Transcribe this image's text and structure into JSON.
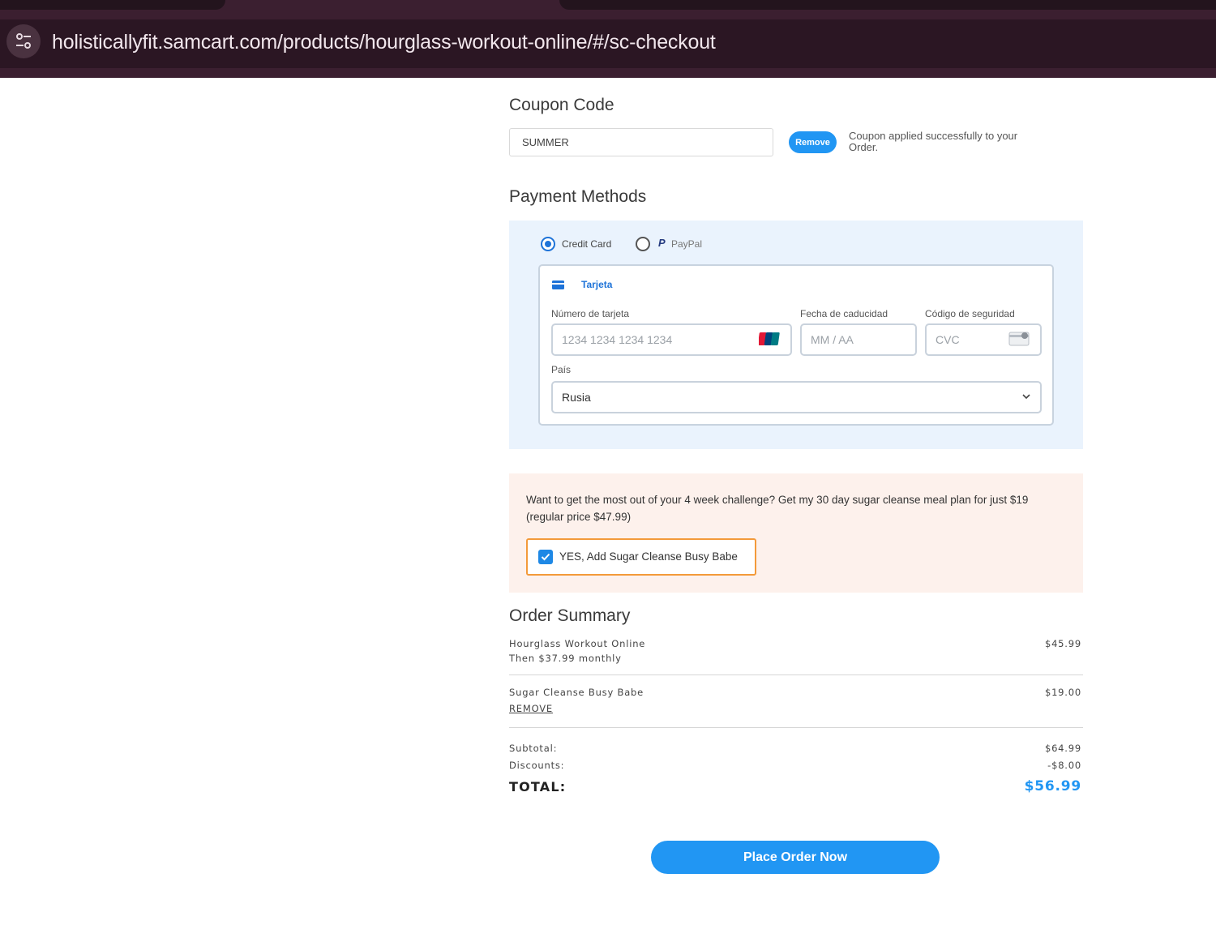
{
  "browser": {
    "url": "holisticallyfit.samcart.com/products/hourglass-workout-online/#/sc-checkout"
  },
  "coupon": {
    "heading": "Coupon Code",
    "value": "SUMMER",
    "remove_label": "Remove",
    "message": "Coupon applied successfully to your Order."
  },
  "payment": {
    "heading": "Payment Methods",
    "methods": [
      {
        "label": "Credit Card",
        "selected": true
      },
      {
        "label": "PayPal",
        "selected": false
      }
    ],
    "card_tab": "Tarjeta",
    "card_number_label": "Número de tarjeta",
    "card_number_placeholder": "1234 1234 1234 1234",
    "expiry_label": "Fecha de caducidad",
    "expiry_placeholder": "MM / AA",
    "cvc_label": "Código de seguridad",
    "cvc_placeholder": "CVC",
    "country_label": "País",
    "country_value": "Rusia"
  },
  "upsell": {
    "text": "Want to get the most out of your 4 week challenge? Get my 30 day sugar cleanse meal plan for just $19 (regular price $47.99)",
    "checkbox_label": "YES, Add Sugar Cleanse Busy Babe",
    "checked": true
  },
  "order_summary": {
    "heading": "Order Summary",
    "items": [
      {
        "name": "Hourglass Workout Online",
        "sub": "Then $37.99 monthly",
        "price": "$45.99"
      },
      {
        "name": "Sugar Cleanse Busy Babe",
        "sub": "REMOVE",
        "price": "$19.00"
      }
    ],
    "subtotal_label": "Subtotal:",
    "subtotal_value": "$64.99",
    "discounts_label": "Discounts:",
    "discounts_value": "-$8.00",
    "total_label": "TOTAL:",
    "total_value": "$56.99"
  },
  "cta": {
    "label": "Place Order Now"
  },
  "colors": {
    "accent": "#2196f3",
    "upsell_bg": "#fdf1ec",
    "upsell_border": "#f39a3a",
    "payment_bg": "#eaf3fd",
    "browser_chrome": "#2b1623"
  }
}
